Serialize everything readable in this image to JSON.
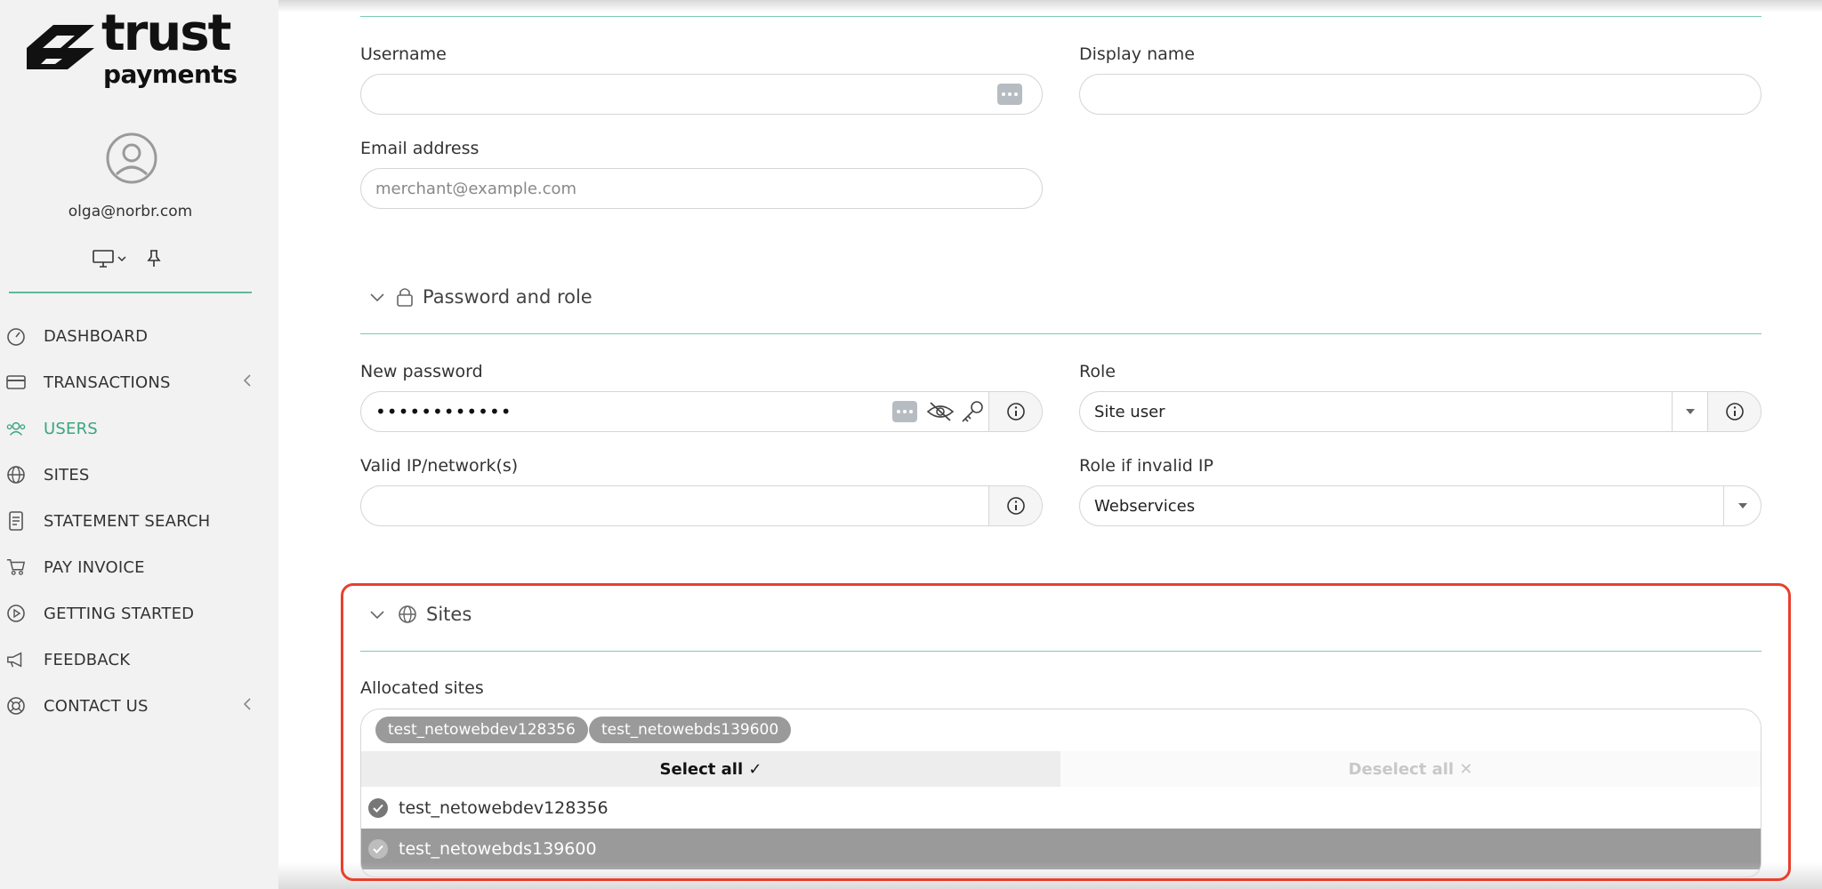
{
  "brand": {
    "line1": "trust",
    "line2": "payments"
  },
  "user": {
    "email": "olga@norbr.com"
  },
  "nav": {
    "items": [
      {
        "label": "DASHBOARD",
        "icon": "dashboard-icon"
      },
      {
        "label": "TRANSACTIONS",
        "icon": "card-icon"
      },
      {
        "label": "USERS",
        "icon": "users-icon"
      },
      {
        "label": "SITES",
        "icon": "globe-icon"
      },
      {
        "label": "STATEMENT SEARCH",
        "icon": "document-icon"
      },
      {
        "label": "PAY INVOICE",
        "icon": "cart-icon"
      },
      {
        "label": "GETTING STARTED",
        "icon": "play-icon"
      },
      {
        "label": "FEEDBACK",
        "icon": "megaphone-icon"
      },
      {
        "label": "CONTACT US",
        "icon": "lifebuoy-icon"
      }
    ]
  },
  "form": {
    "username_label": "Username",
    "username_value": "",
    "display_name_label": "Display name",
    "display_name_value": "",
    "email_label": "Email address",
    "email_placeholder": "merchant@example.com",
    "password_section_title": "Password and role",
    "new_password_label": "New password",
    "new_password_value": "••••••••••••",
    "role_label": "Role",
    "role_value": "Site user",
    "valid_ip_label": "Valid IP/network(s)",
    "valid_ip_value": "",
    "role_invalid_ip_label": "Role if invalid IP",
    "role_invalid_ip_value": "Webservices"
  },
  "sites": {
    "section_title": "Sites",
    "allocated_label": "Allocated sites",
    "chips": [
      "test_netowebdev128356",
      "test_netowebds139600"
    ],
    "select_all": "Select all ✓",
    "deselect_all": "Deselect all ✕",
    "options": [
      "test_netowebdev128356",
      "test_netowebds139600"
    ]
  },
  "colors": {
    "accent": "#3aa57d",
    "highlight": "#e8402e"
  }
}
